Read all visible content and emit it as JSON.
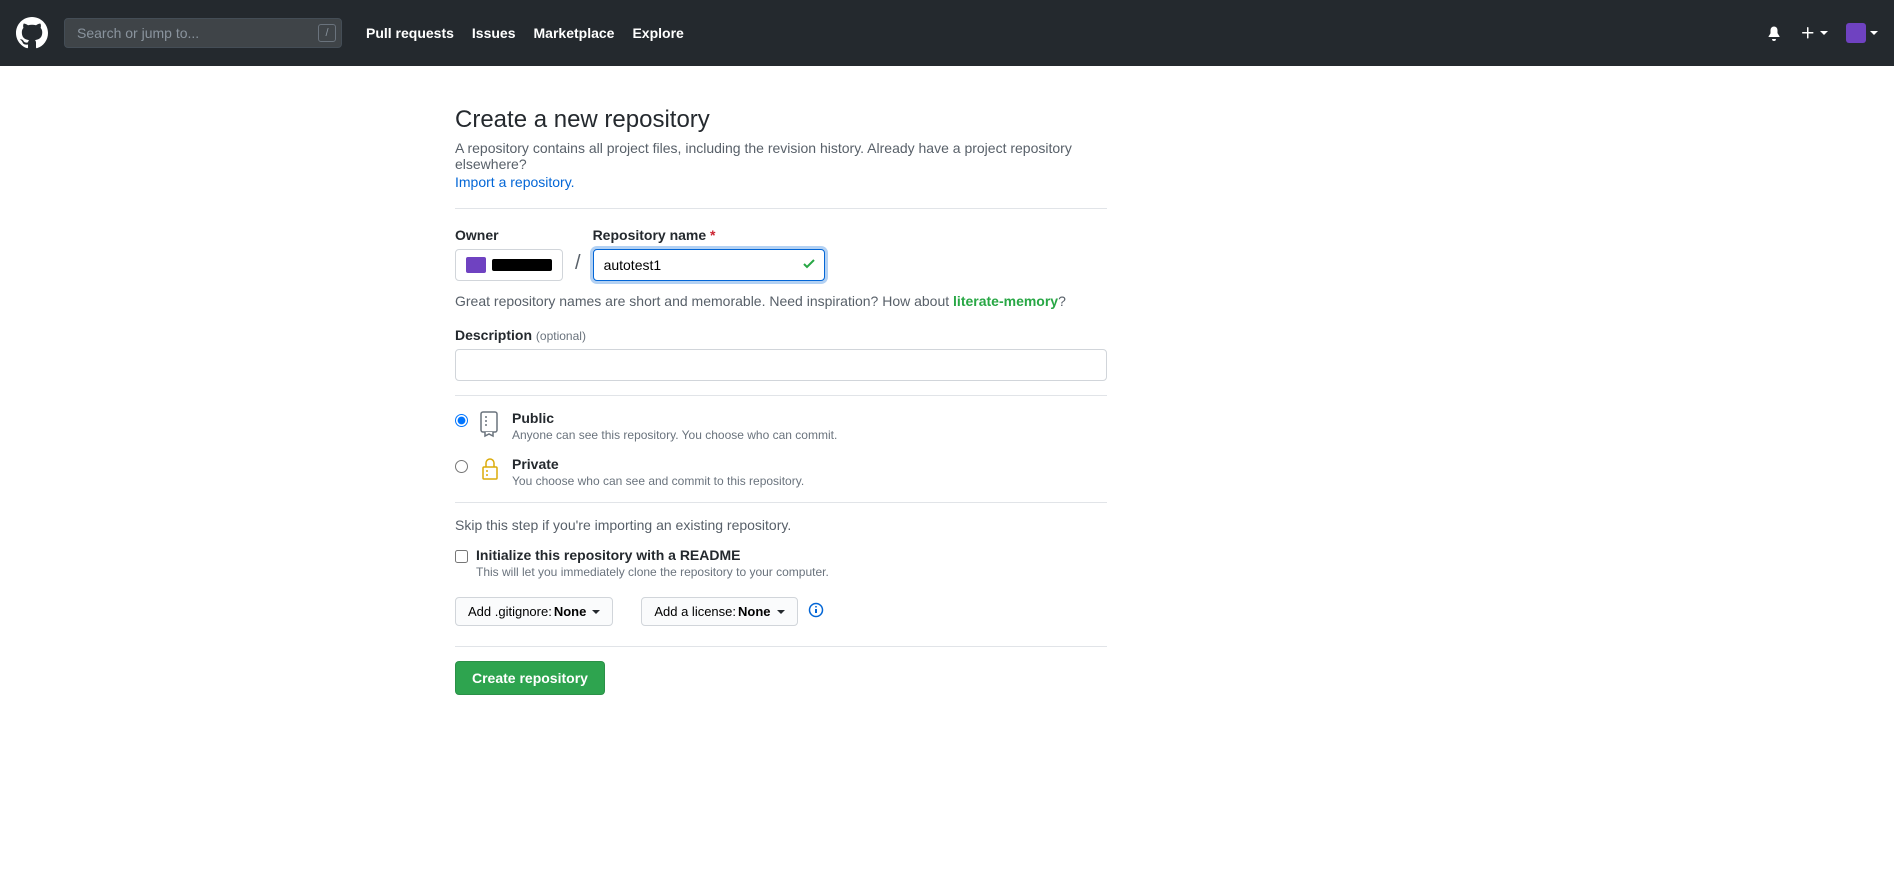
{
  "header": {
    "search_placeholder": "Search or jump to...",
    "slash_key": "/",
    "nav": {
      "pulls": "Pull requests",
      "issues": "Issues",
      "marketplace": "Marketplace",
      "explore": "Explore"
    }
  },
  "page": {
    "title": "Create a new repository",
    "subtitle_prefix": "A repository contains all project files, including the revision history. Already have a project repository elsewhere? ",
    "import_link": "Import a repository."
  },
  "form": {
    "owner_label": "Owner",
    "repo_label": "Repository name",
    "required_mark": "*",
    "repo_value": "autotest1",
    "hint_prefix": "Great repository names are short and memorable. Need inspiration? How about ",
    "hint_suggestion": "literate-memory",
    "hint_suffix": "?",
    "desc_label": "Description",
    "desc_optional": "(optional)",
    "desc_value": "",
    "visibility": {
      "public": {
        "title": "Public",
        "desc": "Anyone can see this repository. You choose who can commit."
      },
      "private": {
        "title": "Private",
        "desc": "You choose who can see and commit to this repository."
      }
    },
    "skip_hint": "Skip this step if you're importing an existing repository.",
    "init": {
      "title": "Initialize this repository with a README",
      "desc": "This will let you immediately clone the repository to your computer."
    },
    "gitignore": {
      "prefix": "Add .gitignore: ",
      "value": "None"
    },
    "license": {
      "prefix": "Add a license: ",
      "value": "None"
    },
    "submit": "Create repository"
  }
}
